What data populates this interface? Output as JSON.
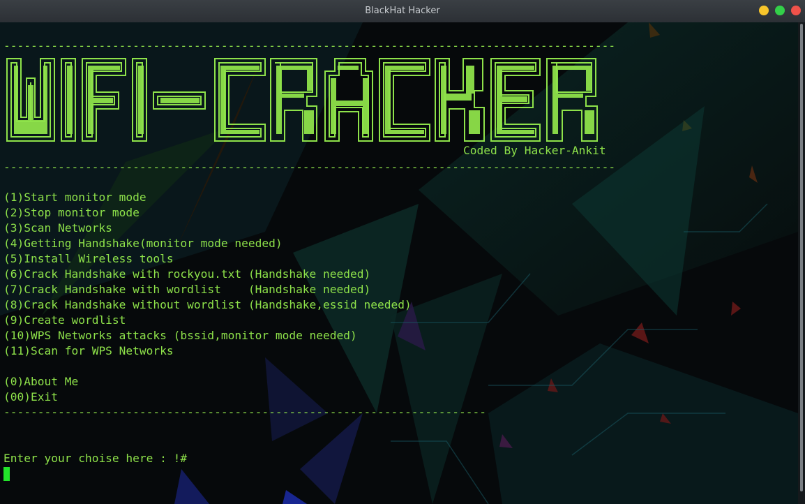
{
  "window": {
    "title": "BlackHat Hacker"
  },
  "colors": {
    "accent": "#8ee24a",
    "cursor": "#22e52a",
    "background": "#070a0c"
  },
  "icons": {
    "minimize": "minimize-dot-icon",
    "maximize": "maximize-dot-icon",
    "close": "close-dot-icon"
  },
  "banner": {
    "title": "WIFI-CRACKER",
    "credit": "Coded By Hacker-Ankit"
  },
  "separators": {
    "top": "------------------------------------------------------------------------------------------",
    "bottom": "------------------------------------------------------------------------",
    "menu_end": "-----------------------------------------------------------------------"
  },
  "menu": [
    "(1)Start monitor mode",
    "(2)Stop monitor mode",
    "(3)Scan Networks",
    "(4)Getting Handshake(monitor mode needed)",
    "(5)Install Wireless tools",
    "(6)Crack Handshake with rockyou.txt (Handshake needed)",
    "(7)Crack Handshake with wordlist    (Handshake needed)",
    "(8)Crack Handshake without wordlist (Handshake,essid needed)",
    "(9)Create wordlist",
    "(10)WPS Networks attacks (bssid,monitor mode needed)",
    "(11)Scan for WPS Networks",
    "",
    "(0)About Me",
    "(00)Exit"
  ],
  "prompt": {
    "text": "Enter your choise here : !#"
  }
}
